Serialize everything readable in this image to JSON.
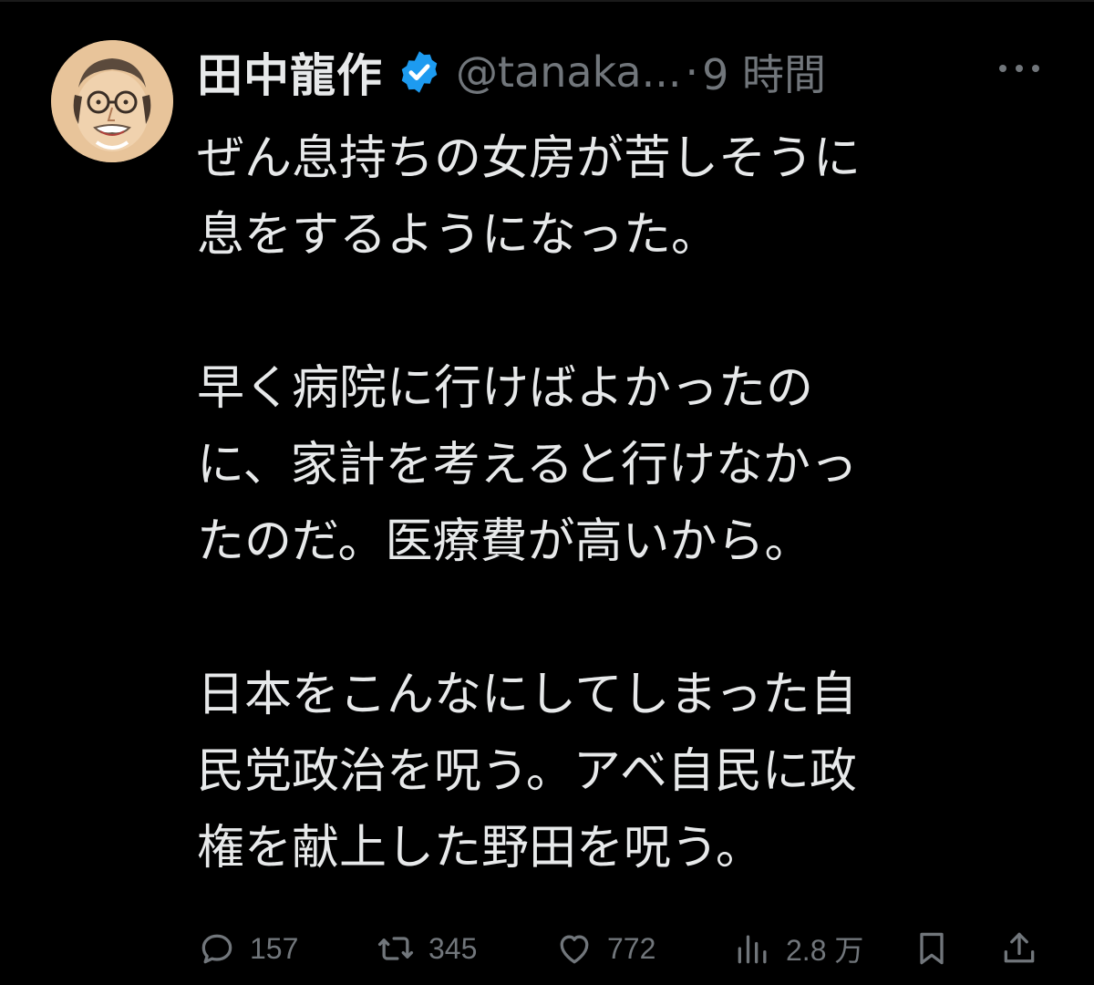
{
  "post": {
    "author": {
      "display_name": "田中龍作",
      "handle": "@tanaka...",
      "verified": true,
      "verified_color": "#1d9bf0"
    },
    "separator": "·",
    "time": "9 時間",
    "paragraphs": [
      "ぜん息持ちの女房が苦しそうに\n息をするようになった。",
      "早く病院に行けばよかったの\nに、家計を考えると行けなかっ\nたのだ。医療費が高いから。",
      "日本をこんなにしてしまった自\n民党政治を呪う。アベ自民に政\n権を献上した野田を呪う。"
    ],
    "stats": {
      "replies": "157",
      "reposts": "345",
      "likes": "772",
      "views": "2.8 万"
    }
  },
  "icons": {
    "avatar": "avatar-illustration",
    "verified": "verified-badge-icon",
    "more": "more-icon",
    "reply": "reply-icon",
    "repost": "repost-icon",
    "like": "like-icon",
    "views": "views-icon",
    "bookmark": "bookmark-icon",
    "share": "share-icon"
  },
  "colors": {
    "background": "#000000",
    "text": "#e7e9ea",
    "muted": "#71767b",
    "accent": "#1d9bf0"
  }
}
